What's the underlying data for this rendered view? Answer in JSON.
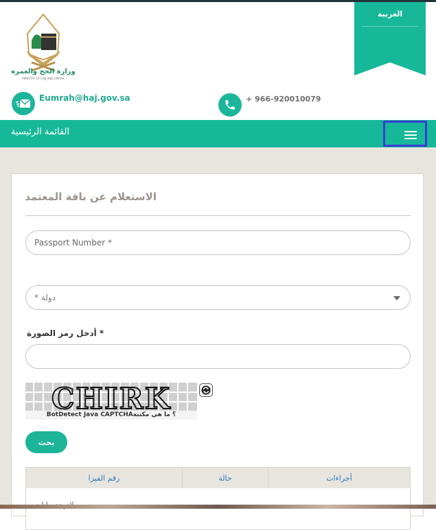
{
  "header": {
    "logo_alt": "وزارة الحج والعمرة",
    "logo_subtitle": "MINISTRY OF HAJJ AND UMRAH",
    "language_label": "العربية",
    "email": "Eumrah@haj.gov.sa",
    "phone": "+ 966-920010079"
  },
  "nav": {
    "title": "القائمة الرئيسية",
    "menu_icon": "hamburger-menu-icon"
  },
  "form": {
    "title": "الاستعلام عن باقة المعتمد",
    "passport_placeholder": "Passport Number *",
    "country_placeholder": "* دولة",
    "captcha_label": "* أدخل رمز الصورة",
    "captcha_value": "",
    "captcha_text": "CHIRK",
    "captcha_caption": "BotDetect Java CAPTCHA؟ ما هي مكتبة",
    "search_label": "بحث"
  },
  "table": {
    "columns": [
      "أجراءات",
      "حالة",
      "رقم الفيزا"
    ],
    "empty_message": "لاتوجد بيانات"
  },
  "colors": {
    "brand": "#17b89a",
    "highlight": "#3a3fd4",
    "background": "#e8e5df"
  }
}
